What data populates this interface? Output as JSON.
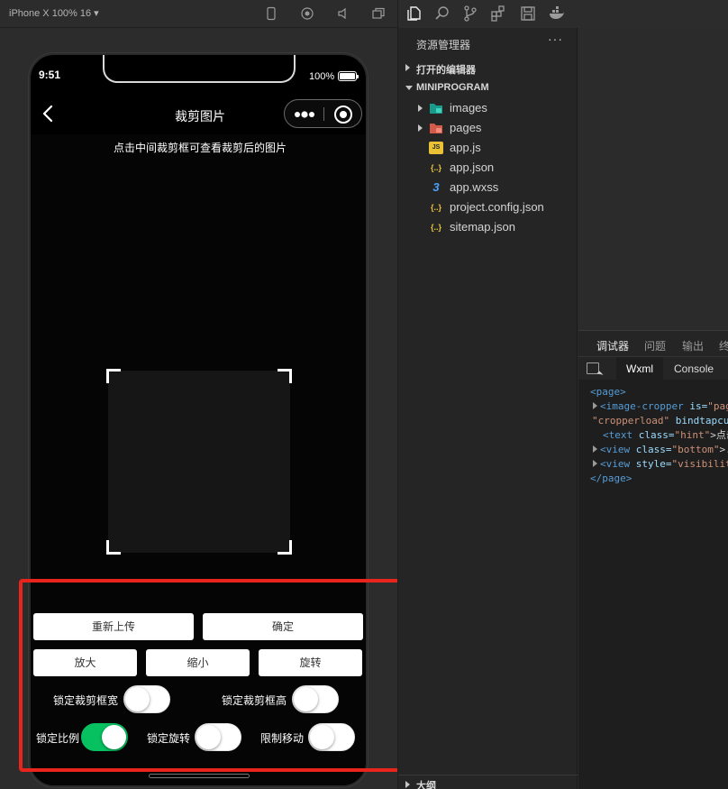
{
  "simulator": {
    "device_label": "iPhone X 100% 16 ▾",
    "toolbar_icons": [
      "phone-icon",
      "record-icon",
      "speaker-icon",
      "window-icon"
    ]
  },
  "phone": {
    "time": "9:51",
    "battery_pct": "100%",
    "battery_level": 1.0,
    "nav_title": "裁剪图片",
    "hint": "点击中间裁剪框可查看裁剪后的图片",
    "buttons": {
      "reupload": "重新上传",
      "confirm": "确定",
      "zoom_in": "放大",
      "zoom_out": "缩小",
      "rotate": "旋转"
    },
    "switches": {
      "lock_width": {
        "label": "锁定裁剪框宽",
        "on": false
      },
      "lock_height": {
        "label": "锁定裁剪框高",
        "on": false
      },
      "lock_ratio": {
        "label": "锁定比例",
        "on": true
      },
      "lock_rotate": {
        "label": "锁定旋转",
        "on": false
      },
      "limit_move": {
        "label": "限制移动",
        "on": false
      }
    },
    "switch_on_color": "#07c160",
    "highlight_color": "#e8241c"
  },
  "explorer": {
    "title": "资源管理器",
    "more": "···",
    "open_editors": "打开的编辑器",
    "project": "MINIPROGRAM",
    "items": [
      {
        "label": "images",
        "icon": "folder-images-icon",
        "folder": true
      },
      {
        "label": "pages",
        "icon": "folder-pages-icon",
        "folder": true
      },
      {
        "label": "app.js",
        "icon": "js-file-icon",
        "badge": "JS",
        "folder": false
      },
      {
        "label": "app.json",
        "icon": "json-file-icon",
        "badge": "{..}",
        "folder": false
      },
      {
        "label": "app.wxss",
        "icon": "wxss-file-icon",
        "badge": "3",
        "folder": false
      },
      {
        "label": "project.config.json",
        "icon": "json-file-icon",
        "badge": "{..}",
        "folder": false
      },
      {
        "label": "sitemap.json",
        "icon": "json-file-icon",
        "badge": "{..}",
        "folder": false
      }
    ],
    "bottom_section": "大纲"
  },
  "debugger": {
    "tabs": [
      "调试器",
      "问题",
      "输出",
      "终"
    ],
    "subtabs": [
      "Wxml",
      "Console"
    ],
    "code": {
      "l1": "<page>",
      "l2_tag": "<image-cropper",
      "l2_attr": " is=",
      "l2_str": "\"pag",
      "l3_str": "\"cropperload\"",
      "l3_attr": " bindtapcu",
      "l4_tag": "<text",
      "l4_attr": " class=",
      "l4_str": "\"hint\"",
      "l4_txt": ">点击",
      "l5_tag": "<view",
      "l5_attr": " class=",
      "l5_str": "\"bottom\"",
      "l5_txt": ">.",
      "l6_tag": "<view",
      "l6_attr": " style=",
      "l6_str": "\"visibilit",
      "l7": "</page>"
    }
  }
}
